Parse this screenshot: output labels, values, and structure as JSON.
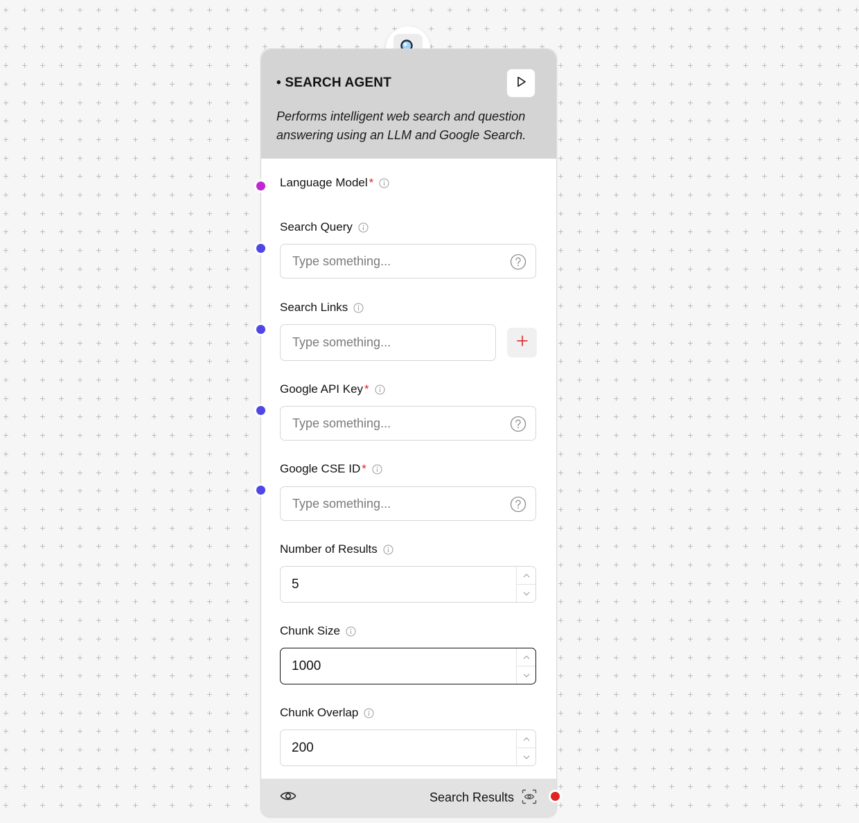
{
  "node": {
    "title": "• SEARCH AGENT",
    "description": "Performs intelligent web search and question answering using an LLM and Google Search.",
    "badge_icon": "magnifier-icon",
    "run_icon": "play-icon"
  },
  "fields": {
    "language_model": {
      "label": "Language Model",
      "required": "*",
      "handle_color": "#c026d3"
    },
    "search_query": {
      "label": "Search Query",
      "placeholder": "Type something...",
      "handle_color": "#4f46e5"
    },
    "search_links": {
      "label": "Search Links",
      "placeholder": "Type something...",
      "add_icon": "plus-icon",
      "handle_color": "#4f46e5"
    },
    "google_api_key": {
      "label": "Google API Key",
      "required": "*",
      "placeholder": "Type something...",
      "handle_color": "#4f46e5"
    },
    "google_cse_id": {
      "label": "Google CSE ID",
      "required": "*",
      "placeholder": "Type something...",
      "handle_color": "#4f46e5"
    },
    "number_of_results": {
      "label": "Number of Results",
      "value": "5"
    },
    "chunk_size": {
      "label": "Chunk Size",
      "value": "1000"
    },
    "chunk_overlap": {
      "label": "Chunk Overlap",
      "value": "200"
    }
  },
  "footer": {
    "output_label": "Search Results",
    "output_handle_color": "#e02424",
    "toggle_icon": "eye-icon",
    "inspect_icon": "inspect-eye-icon"
  },
  "colors": {
    "canvas": "#f6f6f6",
    "grid_plus": "#bdbdbd",
    "header": "#d4d4d4",
    "required": "#e02424",
    "add_icon": "#e02424"
  }
}
